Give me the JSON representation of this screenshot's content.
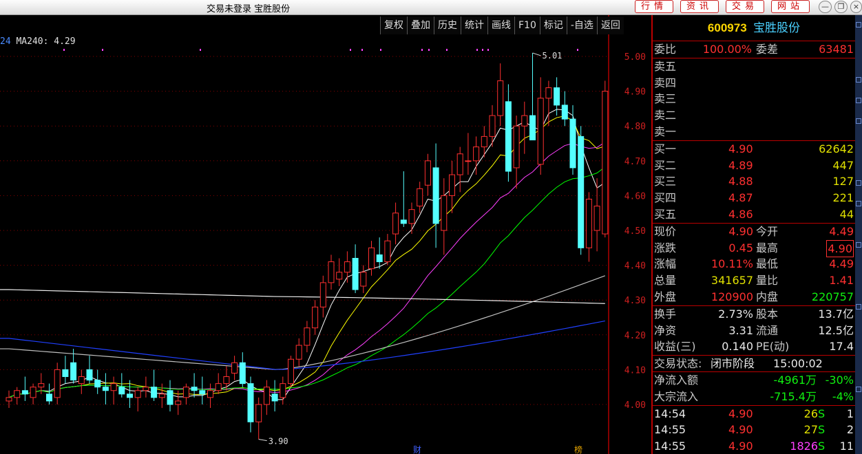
{
  "app": {
    "title": "交易未登录  宝胜股份"
  },
  "top_buttons": [
    "行情",
    "资讯",
    "交易",
    "网站"
  ],
  "toolbar": [
    "复权",
    "叠加",
    "历史",
    "统计",
    "画线",
    "F10",
    "标记",
    "-自选",
    "返回"
  ],
  "ma_label": {
    "prefix": "24",
    "text": "MA240: 4.29"
  },
  "price_axis": [
    "5.00",
    "4.90",
    "4.80",
    "4.70",
    "4.60",
    "4.50",
    "4.40",
    "4.30",
    "4.20",
    "4.10",
    "4.00"
  ],
  "annotations": {
    "high": "5.01",
    "low": "3.90",
    "cai": "财",
    "bang": "榜"
  },
  "stock": {
    "code": "600973",
    "name": "宝胜股份"
  },
  "weibi": {
    "label": "委比",
    "value": "100.00%",
    "label2": "委差",
    "value2": "63481"
  },
  "sell_levels": [
    "卖五",
    "卖四",
    "卖三",
    "卖二",
    "卖一"
  ],
  "buy_levels": [
    {
      "label": "买一",
      "price": "4.90",
      "vol": "62642"
    },
    {
      "label": "买二",
      "price": "4.89",
      "vol": "447"
    },
    {
      "label": "买三",
      "price": "4.88",
      "vol": "127"
    },
    {
      "label": "买四",
      "price": "4.87",
      "vol": "221"
    },
    {
      "label": "买五",
      "price": "4.86",
      "vol": "44"
    }
  ],
  "quote": [
    {
      "l1": "现价",
      "v1": "4.90",
      "l2": "今开",
      "v2": "4.49"
    },
    {
      "l1": "涨跌",
      "v1": "0.45",
      "l2": "最高",
      "v2": "4.90"
    },
    {
      "l1": "涨幅",
      "v1": "10.11%",
      "l2": "最低",
      "v2": "4.49"
    },
    {
      "l1": "总量",
      "v1": "341657",
      "l2": "量比",
      "v2": "1.41"
    },
    {
      "l1": "外盘",
      "v1": "120900",
      "l2": "内盘",
      "v2": "220757"
    }
  ],
  "fundamentals": [
    {
      "l1": "换手",
      "v1": "2.73%",
      "l2": "股本",
      "v2": "13.7亿"
    },
    {
      "l1": "净资",
      "v1": "3.31",
      "l2": "流通",
      "v2": "12.5亿"
    },
    {
      "l1": "收益(三)",
      "v1": "0.140",
      "l2": "PE(动)",
      "v2": "17.4"
    }
  ],
  "status": {
    "label": "交易状态:",
    "value": "闭市阶段",
    "time": "15:00:02"
  },
  "flows": [
    {
      "label": "净流入额",
      "value": "-4961万",
      "pct": "-30%"
    },
    {
      "label": "大宗流入",
      "value": "-715.4万",
      "pct": "-4%"
    }
  ],
  "ticks": [
    {
      "time": "14:54",
      "price": "4.90",
      "vol": "26",
      "side": "S",
      "n": "1"
    },
    {
      "time": "14:55",
      "price": "4.90",
      "vol": "27",
      "side": "S",
      "n": "2"
    },
    {
      "time": "14:55",
      "price": "4.90",
      "vol": "1826",
      "side": "S",
      "n": "11"
    }
  ],
  "chart_data": {
    "type": "candlestick",
    "ylim": [
      3.9,
      5.05
    ],
    "candles": [
      [
        4.01,
        4.04,
        3.99,
        4.02
      ],
      [
        4.02,
        4.05,
        4.0,
        4.04
      ],
      [
        4.04,
        4.08,
        4.01,
        4.03
      ],
      [
        4.02,
        4.06,
        4.0,
        4.05
      ],
      [
        4.05,
        4.09,
        4.03,
        4.06
      ],
      [
        4.03,
        4.06,
        4.0,
        4.01
      ],
      [
        4.02,
        4.12,
        4.0,
        4.1
      ],
      [
        4.1,
        4.14,
        4.06,
        4.08
      ],
      [
        4.12,
        4.16,
        4.06,
        4.07
      ],
      [
        4.06,
        4.1,
        4.03,
        4.08
      ],
      [
        4.1,
        4.14,
        4.06,
        4.07
      ],
      [
        4.07,
        4.1,
        4.03,
        4.05
      ],
      [
        4.05,
        4.09,
        4.0,
        4.04
      ],
      [
        4.04,
        4.08,
        4.0,
        4.06
      ],
      [
        4.05,
        4.09,
        4.02,
        4.03
      ],
      [
        4.03,
        4.07,
        3.99,
        4.02
      ],
      [
        4.02,
        4.05,
        3.98,
        4.04
      ],
      [
        4.04,
        4.08,
        4.02,
        4.05
      ],
      [
        4.05,
        4.1,
        4.01,
        4.02
      ],
      [
        4.02,
        4.06,
        3.99,
        4.03
      ],
      [
        4.04,
        4.07,
        3.98,
        4.0
      ],
      [
        4.0,
        4.04,
        3.97,
        4.01
      ],
      [
        4.02,
        4.06,
        4.0,
        4.05
      ],
      [
        4.05,
        4.09,
        4.02,
        4.04
      ],
      [
        4.04,
        4.08,
        4.0,
        4.03
      ],
      [
        4.02,
        4.06,
        3.99,
        4.04
      ],
      [
        4.04,
        4.09,
        4.03,
        4.06
      ],
      [
        4.06,
        4.11,
        4.04,
        4.08
      ],
      [
        4.09,
        4.14,
        4.07,
        4.12
      ],
      [
        4.12,
        4.15,
        4.05,
        4.06
      ],
      [
        4.06,
        4.08,
        3.92,
        3.95
      ],
      [
        3.95,
        4.02,
        3.9,
        4.0
      ],
      [
        4.0,
        4.07,
        3.97,
        4.05
      ],
      [
        4.03,
        4.07,
        3.98,
        4.01
      ],
      [
        4.02,
        4.08,
        4.0,
        4.06
      ],
      [
        4.06,
        4.14,
        4.05,
        4.13
      ],
      [
        4.13,
        4.19,
        4.11,
        4.17
      ],
      [
        4.17,
        4.24,
        4.15,
        4.22
      ],
      [
        4.22,
        4.3,
        4.2,
        4.28
      ],
      [
        4.28,
        4.37,
        4.25,
        4.35
      ],
      [
        4.35,
        4.43,
        4.33,
        4.41
      ],
      [
        4.36,
        4.42,
        4.34,
        4.38
      ],
      [
        4.38,
        4.44,
        4.35,
        4.41
      ],
      [
        4.42,
        4.46,
        4.32,
        4.33
      ],
      [
        4.34,
        4.4,
        4.32,
        4.38
      ],
      [
        4.39,
        4.47,
        4.37,
        4.45
      ],
      [
        4.43,
        4.48,
        4.39,
        4.41
      ],
      [
        4.41,
        4.49,
        4.4,
        4.47
      ],
      [
        4.49,
        4.58,
        4.46,
        4.55
      ],
      [
        4.53,
        4.67,
        4.51,
        4.52
      ],
      [
        4.52,
        4.58,
        4.49,
        4.56
      ],
      [
        4.57,
        4.64,
        4.55,
        4.62
      ],
      [
        4.63,
        4.72,
        4.6,
        4.7
      ],
      [
        4.68,
        4.75,
        4.45,
        4.52
      ],
      [
        4.5,
        4.65,
        4.43,
        4.6
      ],
      [
        4.6,
        4.7,
        4.55,
        4.66
      ],
      [
        4.66,
        4.74,
        4.61,
        4.72
      ],
      [
        4.7,
        4.78,
        4.66,
        4.7
      ],
      [
        4.7,
        4.77,
        4.66,
        4.74
      ],
      [
        4.74,
        4.8,
        4.71,
        4.77
      ],
      [
        4.77,
        4.86,
        4.74,
        4.83
      ],
      [
        4.83,
        4.98,
        4.8,
        4.93
      ],
      [
        4.87,
        4.92,
        4.64,
        4.67
      ],
      [
        4.68,
        4.83,
        4.62,
        4.8
      ],
      [
        4.8,
        4.87,
        4.72,
        4.83
      ],
      [
        4.83,
        5.01,
        4.76,
        4.76
      ],
      [
        4.69,
        4.94,
        4.66,
        4.88
      ],
      [
        4.88,
        4.93,
        4.8,
        4.91
      ],
      [
        4.91,
        4.94,
        4.83,
        4.86
      ],
      [
        4.86,
        4.9,
        4.8,
        4.82
      ],
      [
        4.82,
        4.86,
        4.66,
        4.68
      ],
      [
        4.77,
        4.8,
        4.43,
        4.45
      ],
      [
        4.45,
        4.61,
        4.41,
        4.59
      ],
      [
        4.5,
        4.65,
        4.44,
        4.57
      ],
      [
        4.49,
        4.93,
        4.48,
        4.9
      ]
    ]
  }
}
